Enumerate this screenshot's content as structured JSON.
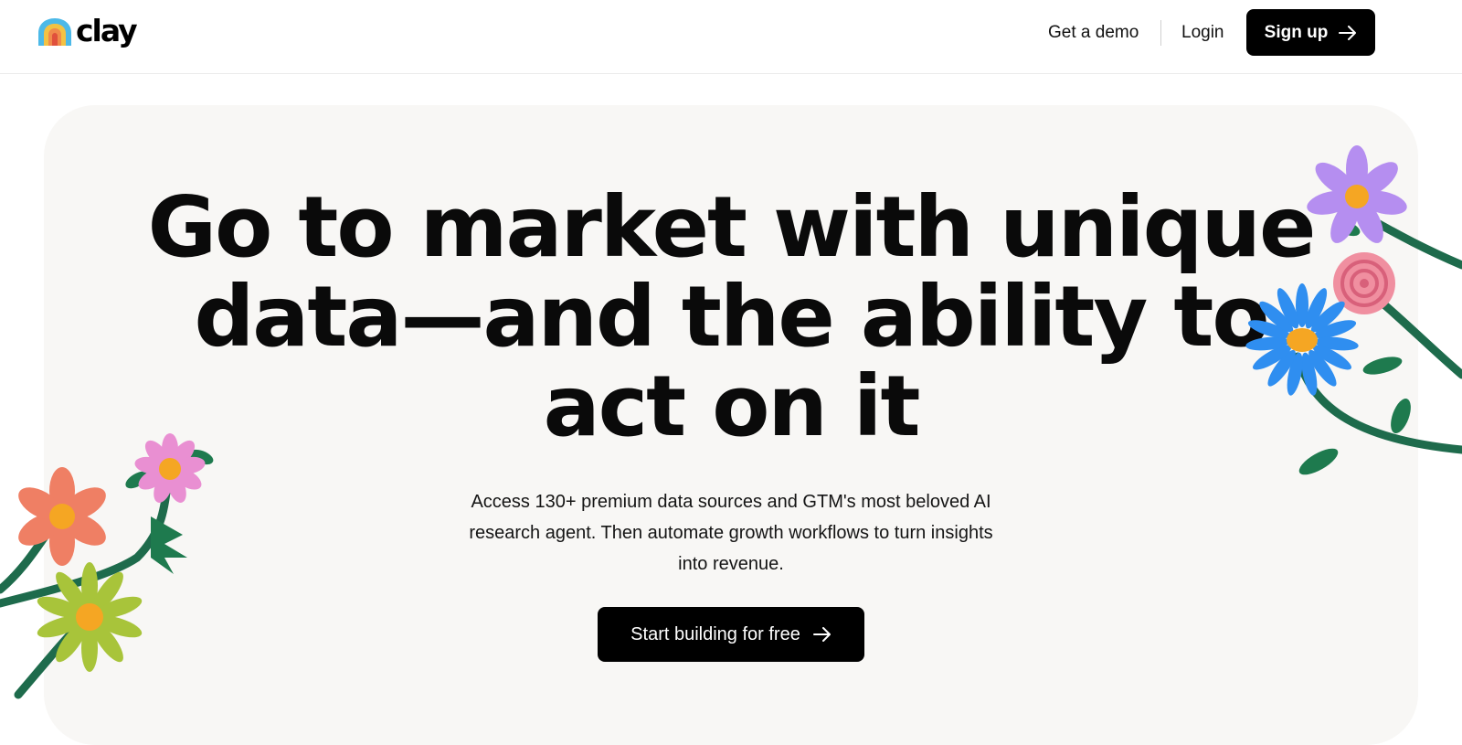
{
  "header": {
    "logo_text": "clay",
    "nav": {
      "demo_label": "Get a demo",
      "login_label": "Login",
      "signup_label": "Sign up"
    }
  },
  "hero": {
    "headline_lines": [
      "Go to market with unique",
      "data—and the ability to",
      "act on it"
    ],
    "subtext_lines": [
      "Access 130+ premium data sources and GTM's most beloved AI",
      "research agent. Then automate growth workflows to turn insights",
      "into revenue."
    ],
    "cta_label": "Start building for free"
  },
  "icons": {
    "logo": "clay-rainbow-arch-icon",
    "signup_arrow": "arrow-right-icon",
    "cta_arrow": "arrow-right-icon"
  },
  "colors": {
    "button_bg": "#000000",
    "button_text": "#ffffff",
    "hero_bg": "#f8f7f5",
    "flower_stem": "#1e6b4c"
  }
}
